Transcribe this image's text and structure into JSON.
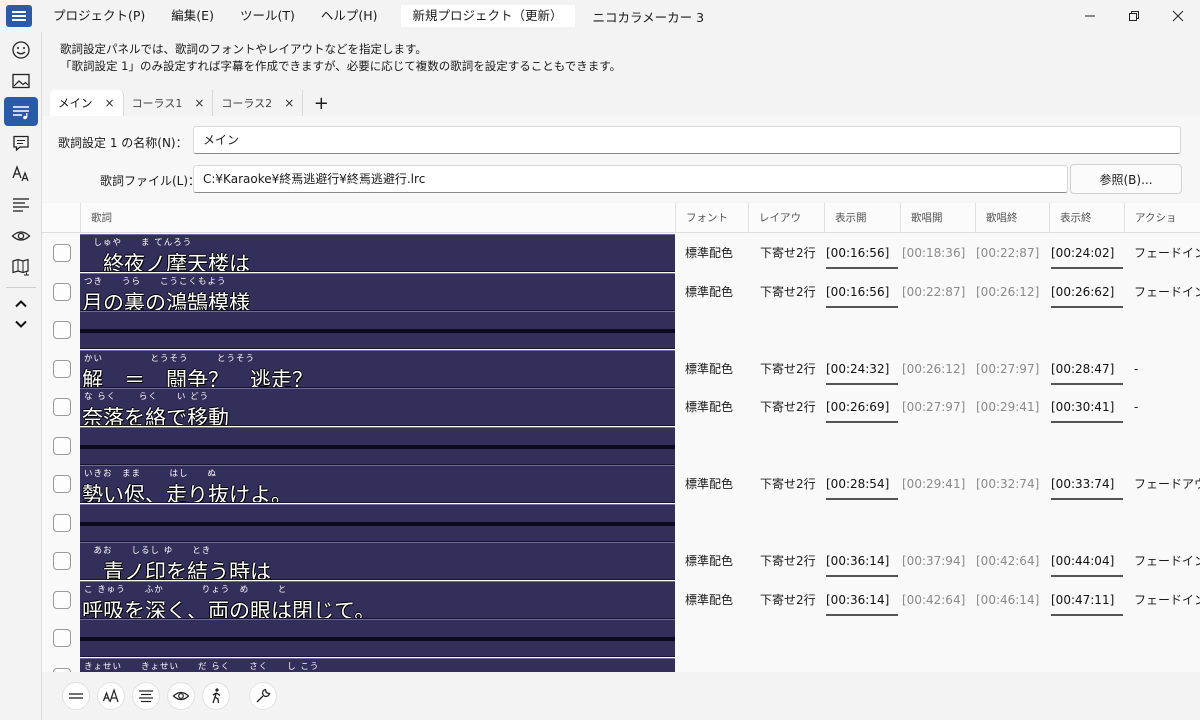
{
  "titlebar": {
    "menu": [
      {
        "key": "project",
        "label": "プロジェクト(P)"
      },
      {
        "key": "edit",
        "label": "編集(E)"
      },
      {
        "key": "tool",
        "label": "ツール(T)"
      },
      {
        "key": "help",
        "label": "ヘルプ(H)"
      }
    ],
    "project_title": "新規プロジェクト（更新）",
    "app_title": "ニコカラメーカー 3",
    "controls": [
      "minimize-icon",
      "restore-icon",
      "close-icon"
    ]
  },
  "sidebar": {
    "items": [
      "smiley-icon",
      "image-icon",
      "lyrics-icon",
      "comment-icon",
      "font-icon",
      "align-icon",
      "eye-icon",
      "map-icon"
    ],
    "active": "lyrics-icon",
    "arrows": [
      "chevron-up-icon",
      "chevron-down-icon"
    ]
  },
  "description": {
    "line1": "歌詞設定パネルでは、歌詞のフォントやレイアウトなどを指定します。",
    "line2": "「歌詞設定 1」のみ設定すれば字幕を作成できますが、必要に応じて複数の歌詞を設定することもできます。"
  },
  "tabs": [
    {
      "label": "メイン",
      "close": "×",
      "active": true
    },
    {
      "label": "コーラス1",
      "close": "×",
      "active": false
    },
    {
      "label": "コーラス2",
      "close": "×",
      "active": false
    }
  ],
  "tab_add": "+",
  "form": {
    "name_label": "歌詞設定 1 の名称(N)：",
    "name_value": "メイン",
    "file_label": "歌詞ファイル(L)：",
    "file_value": "C:¥Karaoke¥終焉逃避行¥終焉逃避行.lrc",
    "browse_label": "参照(B)..."
  },
  "table": {
    "headers": [
      "歌詞",
      "フォント",
      "レイアウ",
      "表示開",
      "歌唱開",
      "歌唱終",
      "表示終",
      "アクショ"
    ],
    "rows": [
      {
        "ruby": "　しゅや　　ま てんろう",
        "text": "＿終夜ノ摩天楼は",
        "font": "標準配色",
        "layout": "下寄せ2行",
        "show_start": "[00:16:56]",
        "sing_start": "[00:18:36]",
        "sing_end": "[00:22:87]",
        "show_end": "[00:24:02]",
        "action": "フェードイン"
      },
      {
        "ruby": "つき　　うら　　こうこくもよう",
        "text": "月の裏の鴻鵠模様",
        "font": "標準配色",
        "layout": "下寄せ2行",
        "show_start": "[00:16:56]",
        "sing_start": "[00:22:87]",
        "sing_end": "[00:26:12]",
        "show_end": "[00:26:62]",
        "action": "フェードイン"
      },
      {
        "empty": true
      },
      {
        "ruby": "かい　　　　　とうそう　　　とうそう",
        "text": "解　＝　闘争？　逃走？",
        "font": "標準配色",
        "layout": "下寄せ2行",
        "show_start": "[00:24:32]",
        "sing_start": "[00:26:12]",
        "sing_end": "[00:27:97]",
        "show_end": "[00:28:47]",
        "action": "-"
      },
      {
        "ruby": "な らく　　 らく　　い どう",
        "text": "奈落を絡で移動",
        "font": "標準配色",
        "layout": "下寄せ2行",
        "show_start": "[00:26:69]",
        "sing_start": "[00:27:97]",
        "sing_end": "[00:29:41]",
        "show_end": "[00:30:41]",
        "action": "-"
      },
      {
        "empty": true
      },
      {
        "ruby": "いきお　まま　　　はし　　ぬ",
        "text": "勢い侭、走り抜けよ。",
        "font": "標準配色",
        "layout": "下寄せ2行",
        "show_start": "[00:28:54]",
        "sing_start": "[00:29:41]",
        "sing_end": "[00:32:74]",
        "show_end": "[00:33:74]",
        "action": "フェードアウ"
      },
      {
        "empty": true
      },
      {
        "ruby": "　あお　　しるし ゆ　　とき",
        "text": "＿青ノ印を結う時は",
        "font": "標準配色",
        "layout": "下寄せ2行",
        "show_start": "[00:36:14]",
        "sing_start": "[00:37:94]",
        "sing_end": "[00:42:64]",
        "show_end": "[00:44:04]",
        "action": "フェードイン"
      },
      {
        "ruby": "こ きゅう　　ふか　　　　りょう　め　　　と",
        "text": "呼吸を深く、両の眼は閉じて。",
        "font": "標準配色",
        "layout": "下寄せ2行",
        "show_start": "[00:36:14]",
        "sing_start": "[00:42:64]",
        "sing_end": "[00:46:14]",
        "show_end": "[00:47:11]",
        "action": "フェードイン"
      },
      {
        "empty": true
      },
      {
        "ruby": "きょせい　　きょせい　　だ らく　　さく　　し こう",
        "text": "",
        "font": "",
        "layout": "",
        "show_start": "",
        "sing_start": "",
        "sing_end": "",
        "show_end": "",
        "action": ""
      }
    ]
  },
  "bottombar": [
    "menu-lines-icon",
    "font-size-icon",
    "align-icon",
    "eye-icon",
    "walker-icon",
    "wrench-icon"
  ]
}
